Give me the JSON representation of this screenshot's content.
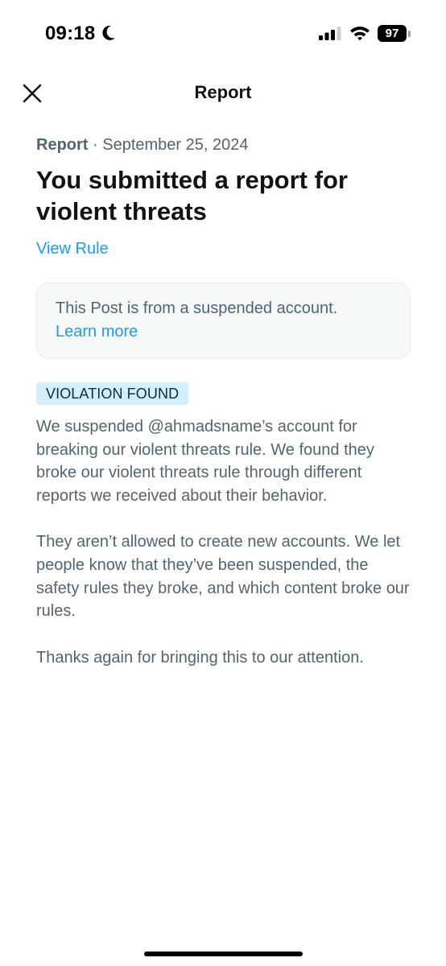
{
  "status_bar": {
    "time": "09:18",
    "battery": "97"
  },
  "nav": {
    "title": "Report"
  },
  "report": {
    "meta_label": "Report",
    "meta_separator": " · ",
    "meta_date": "September 25, 2024",
    "headline": "You submitted a report for violent threats",
    "view_rule": "View Rule"
  },
  "notice": {
    "text": "This Post is from a suspended account.",
    "link": "Learn more"
  },
  "violation": {
    "badge": "VIOLATION FOUND",
    "paragraphs": [
      "We suspended @ahmadsname’s account for breaking our violent threats rule. We found they broke our violent threats rule through different reports we received about their behavior.",
      "They aren’t allowed to create new accounts. We let people know that they’ve been suspended, the safety rules they broke, and which content broke our rules.",
      "Thanks again for bringing this to our attention."
    ]
  },
  "colors": {
    "accent": "#1d9bf0",
    "secondary_text": "#536471",
    "badge_bg": "#d3eefc"
  }
}
